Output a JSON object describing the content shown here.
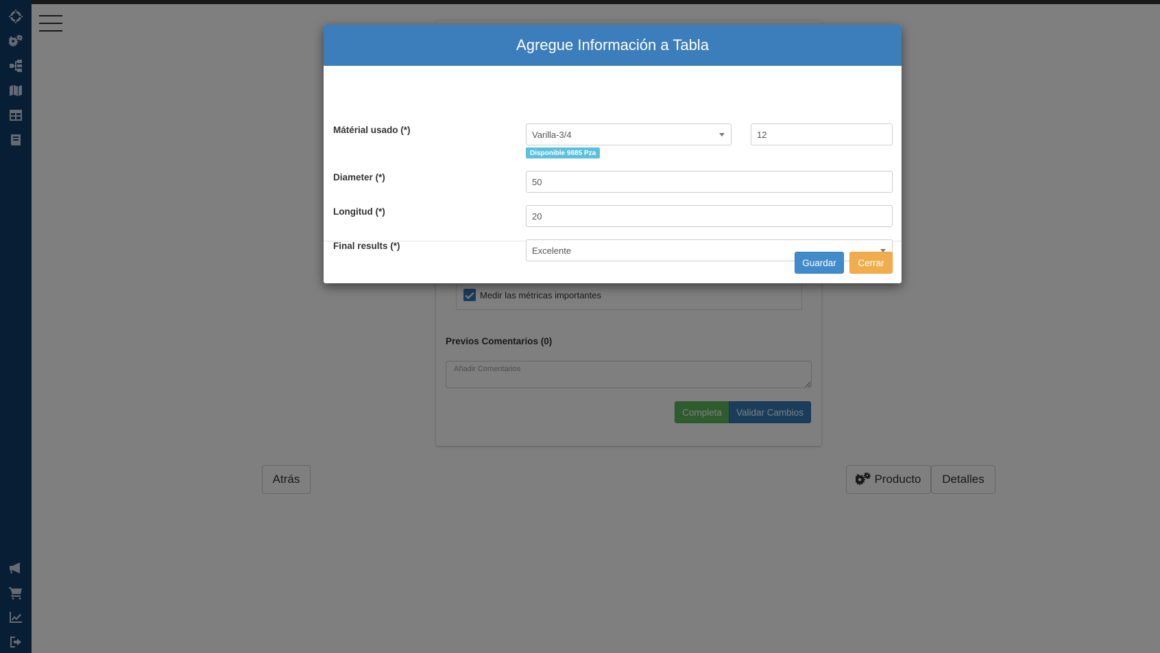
{
  "sidebar": {
    "top_icons": [
      "crosshair-icon",
      "cogs-icon",
      "sitemap-icon",
      "map-icon",
      "table-icon",
      "book-icon"
    ],
    "bottom_icons": [
      "bullhorn-icon",
      "cart-icon",
      "line-chart-icon",
      "sign-out-icon"
    ]
  },
  "background": {
    "checkbox_label": "Medir las métricas importantes",
    "comments_title": "Previos Comentarios (0)",
    "comments_placeholder": "Añadir Comentarios",
    "completa_label": "Completa",
    "validar_label": "Validar Cambios",
    "atras_label": "Atrás",
    "producto_label": "Producto",
    "detalles_label": "Detalles"
  },
  "modal": {
    "title": "Agregue Información a Tabla",
    "material_label": "Mátérial usado (*)",
    "material_value": "Varilla-3/4",
    "quantity_value": "12",
    "available_badge": "Disponible 9885 Pza",
    "diameter_label": "Diameter (*)",
    "diameter_value": "50",
    "longitud_label": "Longitud (*)",
    "longitud_value": "20",
    "final_results_label": "Final results (*)",
    "final_results_value": "Excelente",
    "save_label": "Guardar",
    "close_label": "Cerrar"
  }
}
